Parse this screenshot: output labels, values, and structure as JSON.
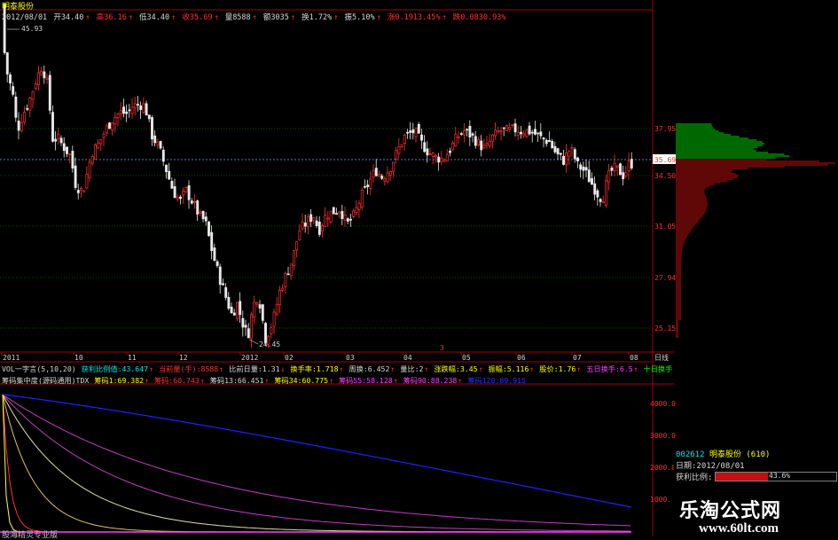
{
  "window": {
    "title": "明泰股份"
  },
  "info_bar": {
    "date": "2012/08/01",
    "open": "开34.40",
    "high": "高36.16",
    "low": "低34.40",
    "close": "收35.69",
    "volume": "量8588",
    "amount": "额3035",
    "turnover": "换1.72%",
    "amplitude": "振5.10%",
    "change": "涨0.1913.45%",
    "extra": "跌0.0830.93%"
  },
  "price_chart": {
    "high_label": "45.93",
    "low_label": "24.45",
    "current_price_tag": "35.69",
    "price_axis_labels": [
      "37.95",
      "34.50",
      "31.05",
      "27.94",
      "25.15"
    ],
    "date_axis_labels": [
      "2011",
      "10",
      "11",
      "12",
      "2012",
      "02",
      "03",
      "04",
      "05",
      "06",
      "07",
      "08"
    ],
    "axis_end_label": "日线",
    "marker": "3"
  },
  "indicator1": {
    "name": "VOL一字言(5,10,20)",
    "profit_ratio_label": "获利比例值:43.647",
    "current_vol_label": "当前量(手):8588",
    "vol_ratio": "比前日量:1.31",
    "turnover_rate": "换手率:1.718",
    "weekly_turnover": "周换:6.452",
    "vol_ratio2": "量比:2",
    "limit_down": "涨跌幅:3.45",
    "amplitude2": "振幅:5.116",
    "avg_price": "股价:1.76",
    "five_day_turnover": "五日换手:6.5",
    "ten_day_turnover": "十日换手"
  },
  "indicator2": {
    "name": "筹码集中度(源码通用)TDX",
    "chip1": "筹码1:69.382",
    "chip2": "筹码:60.743",
    "chip3": "筹码13:66.451",
    "chip4": "筹码34:60.775",
    "chip5": "筹码55:58.128",
    "chip6": "筹码90:88.238",
    "chip7": "筹码120:89.915",
    "y_axis_labels": [
      "4000.0",
      "3000.0",
      "2000.0",
      "1000."
    ]
  },
  "side_panel": {
    "code": "002612",
    "name": "明泰股份",
    "code_suffix": "(610)",
    "date_label": "日期:2012/08/01",
    "profit_label": "获利比例:",
    "profit_value": "43.6%",
    "profit_fraction": 0.436
  },
  "watermark": {
    "site_name": "乐淘公式网",
    "url": "www.60lt.com"
  },
  "bottom_note": "股海精灵专业版",
  "colors": {
    "up": "#ff3030",
    "down": "#e8e8e8",
    "grid": "#00a000",
    "chip_red": "#c01010",
    "chip_green": "#00d000",
    "current_line": "#6aa8ff"
  }
}
